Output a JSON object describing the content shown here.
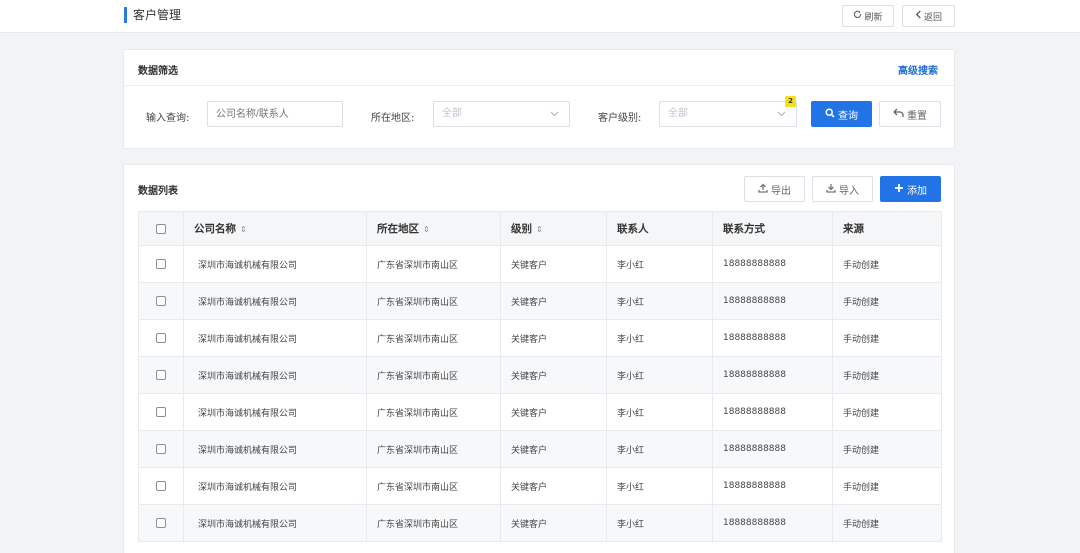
{
  "header": {
    "title": "客户管理",
    "refresh_label": "刷新",
    "back_label": "返回",
    "refresh_icon": "refresh-icon",
    "back_icon": "chevron-left-icon"
  },
  "filter": {
    "title": "数据筛选",
    "advanced_search": "高级搜索",
    "query_label": "输入查询:",
    "query_placeholder": "公司名称/联系人",
    "region_label": "所在地区:",
    "region_value": "全部",
    "level_label": "客户级别:",
    "level_value": "全部",
    "level_badge": "2",
    "search_label": "查询",
    "reset_label": "重置"
  },
  "list": {
    "title": "数据列表",
    "export_label": "导出",
    "import_label": "导入",
    "add_label": "添加",
    "columns": [
      "公司名称",
      "所在地区",
      "级别",
      "联系人",
      "联系方式",
      "来源"
    ],
    "sort_glyph": "⇕",
    "rows": [
      [
        "深圳市海诚机械有限公司",
        "广东省深圳市南山区",
        "关键客户",
        "李小红",
        "18888888888",
        "手动创建"
      ],
      [
        "深圳市海诚机械有限公司",
        "广东省深圳市南山区",
        "关键客户",
        "李小红",
        "18888888888",
        "手动创建"
      ],
      [
        "深圳市海诚机械有限公司",
        "广东省深圳市南山区",
        "关键客户",
        "李小红",
        "18888888888",
        "手动创建"
      ],
      [
        "深圳市海诚机械有限公司",
        "广东省深圳市南山区",
        "关键客户",
        "李小红",
        "18888888888",
        "手动创建"
      ],
      [
        "深圳市海诚机械有限公司",
        "广东省深圳市南山区",
        "关键客户",
        "李小红",
        "18888888888",
        "手动创建"
      ],
      [
        "深圳市海诚机械有限公司",
        "广东省深圳市南山区",
        "关键客户",
        "李小红",
        "18888888888",
        "手动创建"
      ],
      [
        "深圳市海诚机械有限公司",
        "广东省深圳市南山区",
        "关键客户",
        "李小红",
        "18888888888",
        "手动创建"
      ],
      [
        "深圳市海诚机械有限公司",
        "广东省深圳市南山区",
        "关键客户",
        "李小红",
        "18888888888",
        "手动创建"
      ]
    ]
  },
  "colors": {
    "primary": "#2274e6",
    "accent_bar": "#2a7ae2",
    "badge": "#f5e11a"
  }
}
